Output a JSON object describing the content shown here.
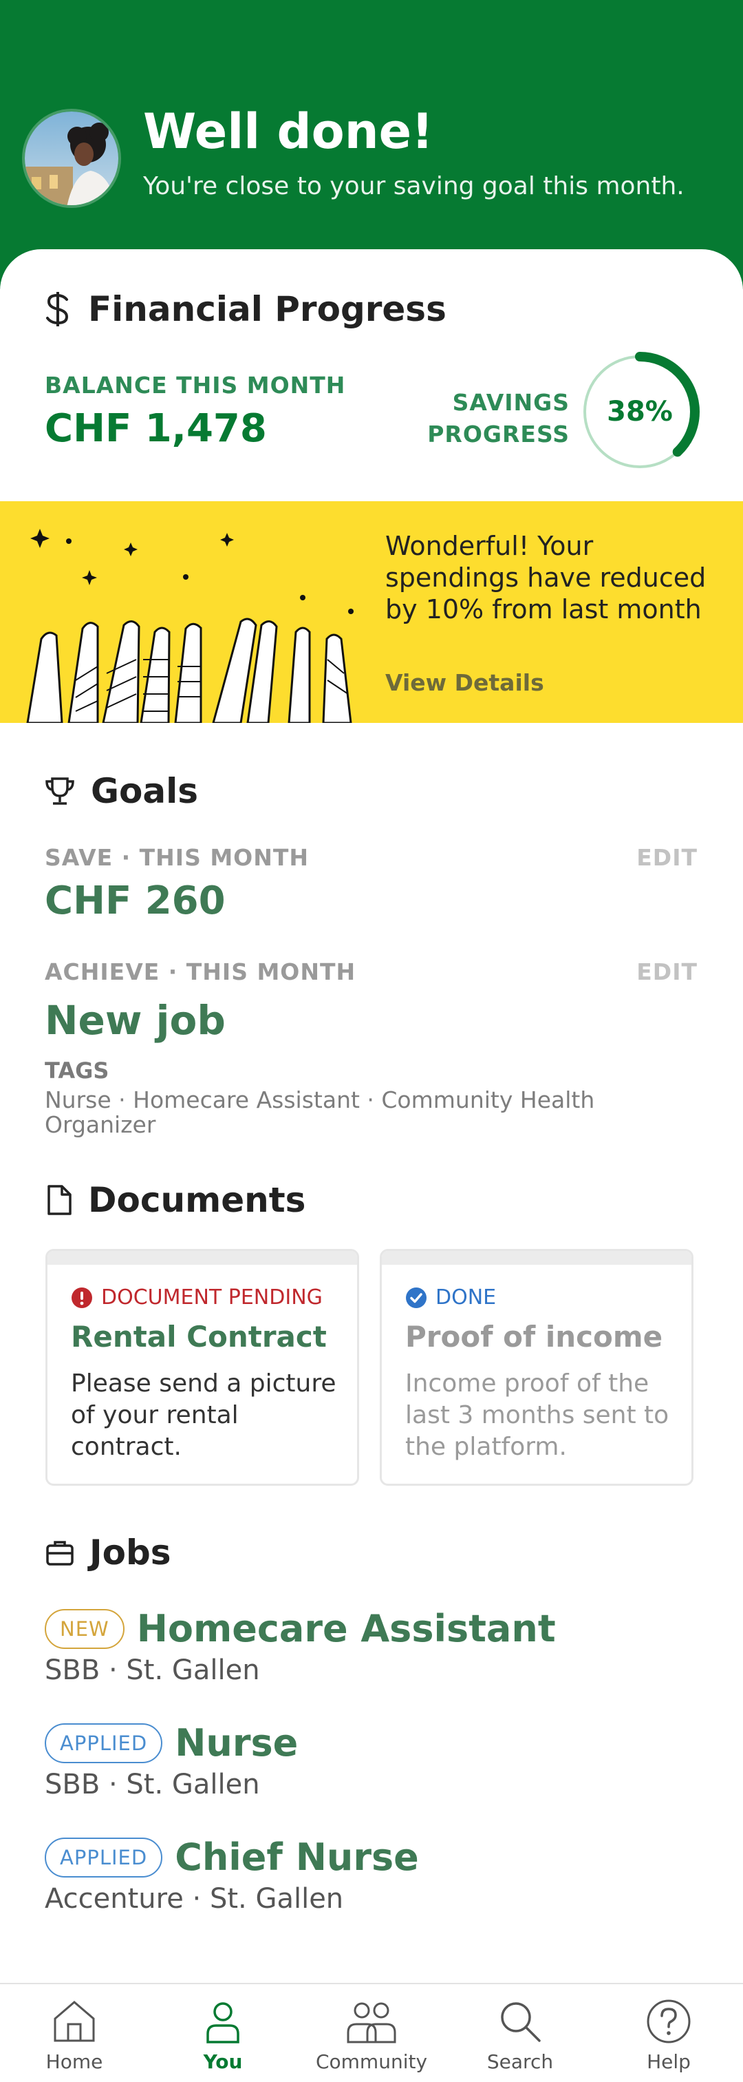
{
  "header": {
    "title": "Well done!",
    "subtitle": "You're close to your saving goal this month."
  },
  "financial": {
    "title": "Financial Progress",
    "balance_label": "BALANCE THIS MONTH",
    "balance_value": "CHF 1,478",
    "savings_label_line1": "SAVINGS",
    "savings_label_line2": "PROGRESS",
    "savings_percent": "38%",
    "savings_fraction": 0.38
  },
  "banner": {
    "text": "Wonderful! Your spendings have reduced by 10% from last month",
    "link": "View Details"
  },
  "goals": {
    "title": "Goals",
    "items": [
      {
        "label": "SAVE · THIS MONTH",
        "value": "CHF 260",
        "edit": "EDIT"
      },
      {
        "label": "ACHIEVE · THIS MONTH",
        "value": "New job",
        "edit": "EDIT"
      }
    ],
    "tags_label": "TAGS",
    "tags": "Nurse · Homecare Assistant · Community Health Organizer"
  },
  "documents": {
    "title": "Documents",
    "items": [
      {
        "status": "DOCUMENT PENDING",
        "title": "Rental Contract",
        "desc": "Please send a picture of your rental contract."
      },
      {
        "status": "DONE",
        "title": "Proof of income",
        "desc": "Income proof of the last 3 months sent to the platform."
      }
    ]
  },
  "jobs": {
    "title": "Jobs",
    "items": [
      {
        "badge": "NEW",
        "title": "Homecare Assistant",
        "sub": "SBB · St. Gallen"
      },
      {
        "badge": "APPLIED",
        "title": "Nurse",
        "sub": "SBB · St. Gallen"
      },
      {
        "badge": "APPLIED",
        "title": "Chief Nurse",
        "sub": "Accenture · St. Gallen"
      }
    ]
  },
  "tabs": [
    {
      "label": "Home",
      "icon": "home-icon"
    },
    {
      "label": "You",
      "icon": "person-icon"
    },
    {
      "label": "Community",
      "icon": "community-icon"
    },
    {
      "label": "Search",
      "icon": "search-icon"
    },
    {
      "label": "Help",
      "icon": "help-icon"
    }
  ],
  "colors": {
    "brand_green": "#067a32",
    "banner_yellow": "#fddd2e",
    "pending_red": "#c0282d",
    "done_blue": "#2f74c8"
  }
}
